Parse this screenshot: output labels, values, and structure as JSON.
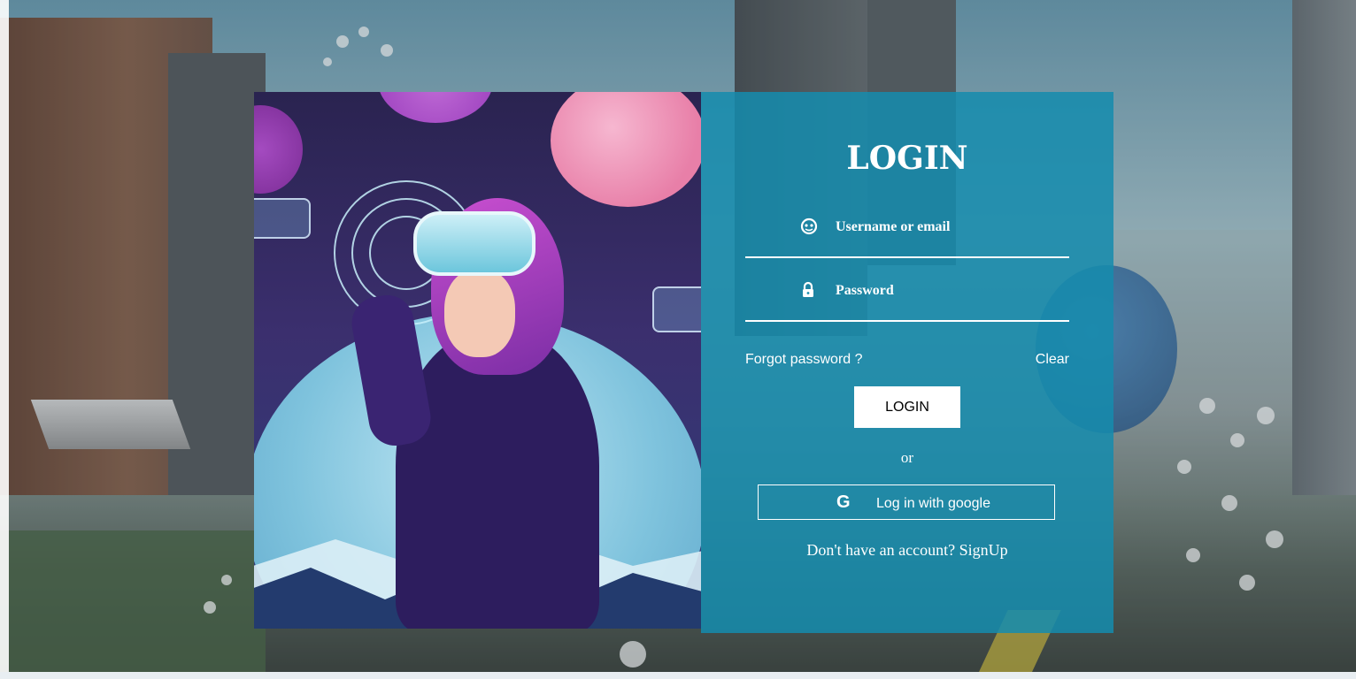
{
  "login_panel": {
    "title": "LOGIN",
    "username_placeholder": "Username or email",
    "password_placeholder": "Password",
    "forgot_password": "Forgot password ?",
    "clear": "Clear",
    "login_button": "LOGIN",
    "or": "or",
    "google_button": "Log in with google",
    "google_icon_letter": "G",
    "signup_text": "Don't have an account? SignUp"
  },
  "icons": {
    "username": "user-face-icon",
    "password": "lock-icon",
    "google": "google-icon"
  },
  "colors": {
    "panel": "#158cad",
    "button_bg": "#ffffff",
    "text": "#ffffff"
  }
}
